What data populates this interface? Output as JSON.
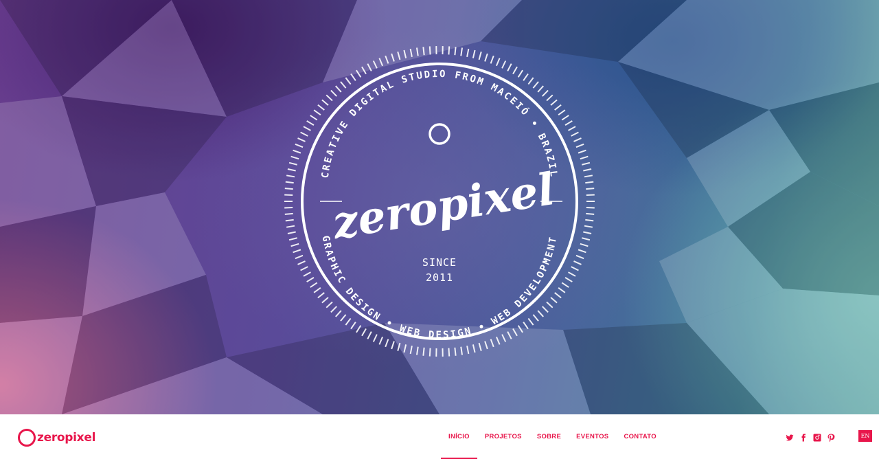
{
  "hero": {
    "arc_top_text": "CREATIVE DIGITAL STUDIO FROM MACEIÓ • BRAZIL",
    "arc_bottom_text": "GRAPHIC DESIGN • WEB DESIGN • WEB DEVELOPMENT",
    "wordmark": "zeropixel",
    "since_label": "SINCE",
    "since_year": "2011"
  },
  "header": {
    "logo_text": "zeropixel",
    "nav": [
      {
        "label": "INÍCIO",
        "active": true
      },
      {
        "label": "PROJETOS",
        "active": false
      },
      {
        "label": "SOBRE",
        "active": false
      },
      {
        "label": "EVENTOS",
        "active": false
      },
      {
        "label": "CONTATO",
        "active": false
      }
    ],
    "social_icons": [
      "twitter-icon",
      "facebook-icon",
      "instagram-icon",
      "pinterest-icon"
    ],
    "language_label": "EN"
  },
  "colors": {
    "accent": "#e8164b",
    "badge_white": "#ffffff"
  }
}
